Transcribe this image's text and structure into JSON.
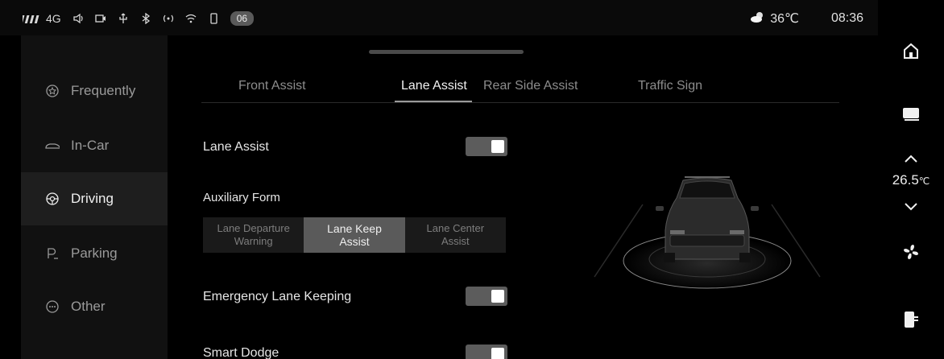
{
  "status_bar": {
    "signal_text": "4G",
    "badge": "06",
    "temperature": "36℃",
    "time": "08:36"
  },
  "sidebar": {
    "items": [
      {
        "label": "Frequently",
        "icon": "star-icon"
      },
      {
        "label": "In-Car",
        "icon": "car-outline-icon"
      },
      {
        "label": "Driving",
        "icon": "steering-wheel-icon"
      },
      {
        "label": "Parking",
        "icon": "parking-icon"
      },
      {
        "label": "Other",
        "icon": "more-icon"
      }
    ]
  },
  "tabs": [
    {
      "label": "Front Assist"
    },
    {
      "label": "Lane Assist"
    },
    {
      "label": "Rear Side Assist"
    },
    {
      "label": "Traffic Sign"
    }
  ],
  "settings": {
    "lane_assist_label": "Lane Assist",
    "lane_assist_on": true,
    "auxiliary_form_label": "Auxiliary Form",
    "auxiliary_options": [
      {
        "line1": "Lane Departure",
        "line2": "Warning"
      },
      {
        "line1": "Lane Keep",
        "line2": "Assist"
      },
      {
        "line1": "Lane Center",
        "line2": "Assist"
      }
    ],
    "auxiliary_selected": "Lane Keep Assist",
    "emergency_label": "Emergency Lane Keeping",
    "emergency_on": true,
    "smart_dodge_label": "Smart Dodge",
    "smart_dodge_on": true
  },
  "rail": {
    "temp_value": "26.5",
    "temp_unit": "℃"
  },
  "colors": {
    "background": "#000000",
    "sidebar_bg": "#111111",
    "active_item_bg": "#1e1e1e",
    "toggle_bg": "#5c5c5c",
    "segment_active": "#5a5a5a"
  }
}
